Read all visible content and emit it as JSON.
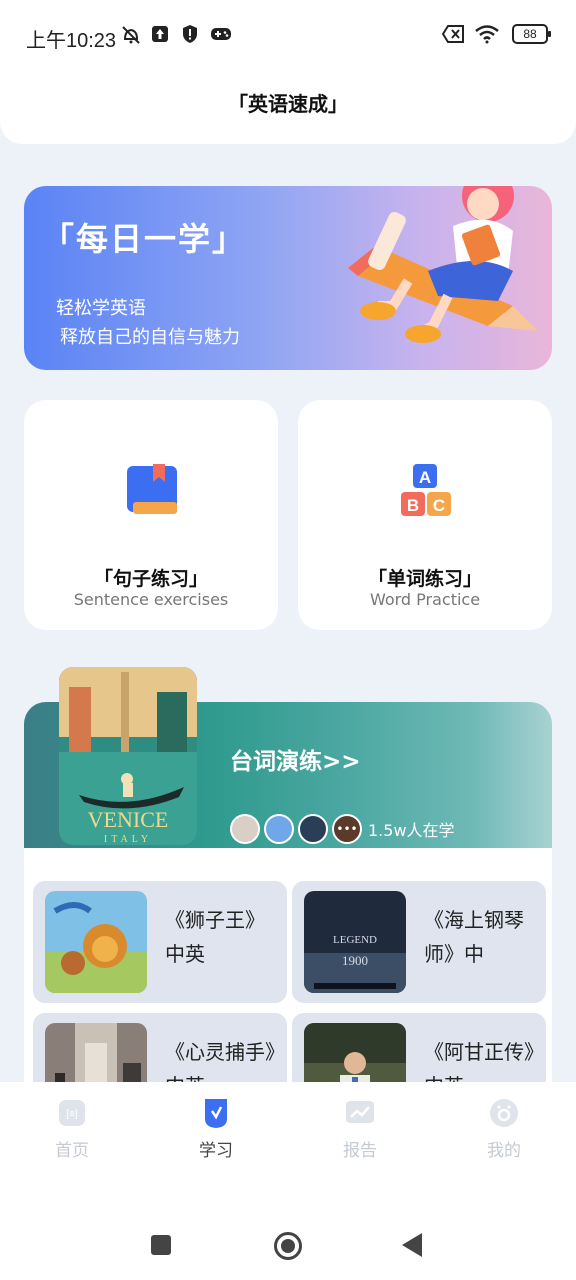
{
  "status": {
    "time": "上午10:23",
    "battery": "88",
    "icons_left": [
      "mute-bell-icon",
      "upload-icon",
      "shield-icon",
      "gamepad-icon"
    ],
    "icons_right": [
      "sim-x-icon",
      "wifi-icon",
      "battery-icon"
    ]
  },
  "header": {
    "title": "「英语速成」"
  },
  "banner": {
    "title": "「每日一学」",
    "sub1": "轻松学英语",
    "sub2": "释放自己的自信与魅力"
  },
  "cards": [
    {
      "title": "「句子练习」",
      "subtitle": "Sentence exercises",
      "icon": "book-icon"
    },
    {
      "title": "「单词练习」",
      "subtitle": "Word Practice",
      "icon": "abc-blocks-icon"
    }
  ],
  "lines": {
    "title": "台词演练>>",
    "learners": "1.5w人在学",
    "poster": {
      "line1": "VENICE",
      "line2": "ITALY"
    }
  },
  "movies": [
    {
      "title": "《狮子王》中英"
    },
    {
      "title": "《海上钢琴师》中"
    },
    {
      "title": "《心灵捕手》中英"
    },
    {
      "title": "《阿甘正传》中英"
    }
  ],
  "movie_poster_text": {
    "legend": "LEGEND",
    "year": "1900"
  },
  "tabs": [
    {
      "label": "首页",
      "icon": "home-icon",
      "active": false
    },
    {
      "label": "学习",
      "icon": "study-icon",
      "active": true
    },
    {
      "label": "报告",
      "icon": "report-icon",
      "active": false
    },
    {
      "label": "我的",
      "icon": "profile-icon",
      "active": false
    }
  ],
  "colors": {
    "accent": "#3b6ef0",
    "background": "#edf1f8",
    "banner_start": "#5a83f5",
    "banner_end": "#e9b6d9",
    "lines_header": "#2f9a8e"
  }
}
